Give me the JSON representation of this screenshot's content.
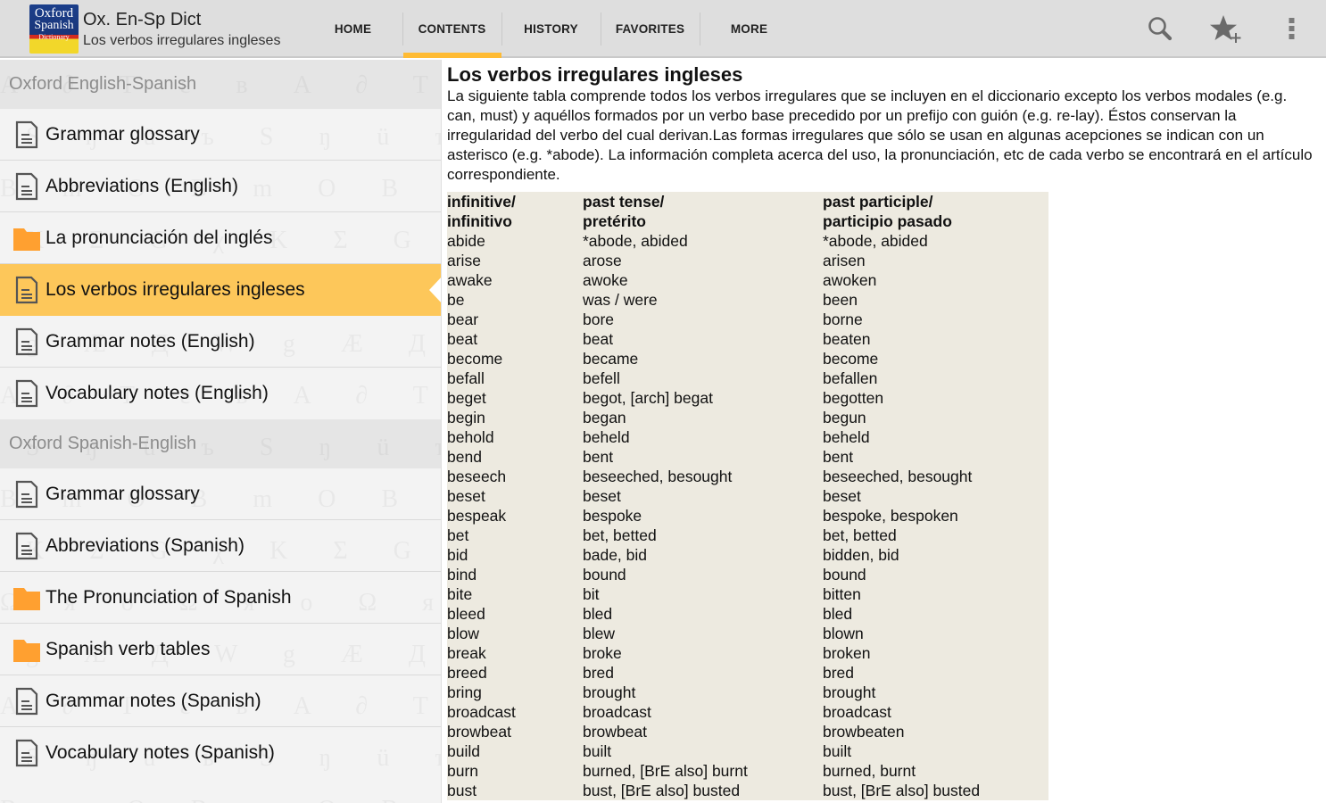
{
  "app": {
    "logo_lines": [
      "Oxford",
      "Spanish",
      "Dictionary"
    ],
    "title": "Ox. En-Sp Dict",
    "subtitle": "Los verbos irregulares ingleses"
  },
  "tabs": [
    {
      "label": "HOME",
      "active": false
    },
    {
      "label": "CONTENTS",
      "active": true
    },
    {
      "label": "HISTORY",
      "active": false
    },
    {
      "label": "FAVORITES",
      "active": false
    },
    {
      "label": "MORE",
      "active": false
    }
  ],
  "actions": [
    {
      "icon": "search-icon"
    },
    {
      "icon": "add-favorite-star-icon"
    },
    {
      "icon": "overflow-menu-icon"
    }
  ],
  "colors": {
    "accent": "#ffbb33",
    "selected_item": "#fdc75a",
    "folder": "#ffa030",
    "table_bg": "#edeae0",
    "actionbar": "#dedede"
  },
  "sidebar": {
    "sections": [
      {
        "header": "Oxford English-Spanish",
        "items": [
          {
            "label": "Grammar glossary",
            "icon": "document-icon",
            "selected": false
          },
          {
            "label": "Abbreviations (English)",
            "icon": "document-icon",
            "selected": false
          },
          {
            "label": "La pronunciación del inglés",
            "icon": "folder-icon",
            "selected": false
          },
          {
            "label": "Los verbos irregulares ingleses",
            "icon": "document-icon",
            "selected": true
          },
          {
            "label": "Grammar notes (English)",
            "icon": "document-icon",
            "selected": false
          },
          {
            "label": "Vocabulary notes (English)",
            "icon": "document-icon",
            "selected": false
          }
        ]
      },
      {
        "header": "Oxford Spanish-English",
        "items": [
          {
            "label": "Grammar glossary",
            "icon": "document-icon",
            "selected": false
          },
          {
            "label": "Abbreviations (Spanish)",
            "icon": "document-icon",
            "selected": false
          },
          {
            "label": "The Pronunciation of Spanish",
            "icon": "folder-icon",
            "selected": false
          },
          {
            "label": "Spanish verb tables",
            "icon": "folder-icon",
            "selected": false
          },
          {
            "label": "Grammar notes (Spanish)",
            "icon": "document-icon",
            "selected": false
          },
          {
            "label": "Vocabulary notes (Spanish)",
            "icon": "document-icon",
            "selected": false
          }
        ]
      }
    ]
  },
  "content": {
    "title": "Los verbos irregulares ingleses",
    "intro": "La siguiente tabla comprende todos los verbos irregulares que se incluyen en el diccionario excepto los verbos modales (e.g. can, must) y aquéllos formados por un verbo base precedido por un prefijo con guión (e.g. re-lay). Éstos conservan la irregularidad del verbo del cual derivan.Las formas irregulares que sólo se usan en algunas acepciones se indican con un asterisco (e.g. *abode). La información completa acerca del uso, la pronunciación, etc de cada verbo se encontrará en el artículo correspondiente.",
    "table": {
      "headers": [
        [
          "infinitive/",
          "infinitivo"
        ],
        [
          "past tense/",
          "pretérito"
        ],
        [
          "past participle/",
          "participio pasado"
        ]
      ],
      "rows": [
        [
          "abide",
          "*abode, abided",
          "*abode, abided"
        ],
        [
          "arise",
          "arose",
          "arisen"
        ],
        [
          "awake",
          "awoke",
          "awoken"
        ],
        [
          "be",
          "was / were",
          "been"
        ],
        [
          "bear",
          "bore",
          "borne"
        ],
        [
          "beat",
          "beat",
          "beaten"
        ],
        [
          "become",
          "became",
          "become"
        ],
        [
          "befall",
          "befell",
          "befallen"
        ],
        [
          "beget",
          "begot, [arch] begat",
          "begotten"
        ],
        [
          "begin",
          "began",
          "begun"
        ],
        [
          "behold",
          "beheld",
          "beheld"
        ],
        [
          "bend",
          "bent",
          "bent"
        ],
        [
          "beseech",
          "beseeched, besought",
          "beseeched, besought"
        ],
        [
          "beset",
          "beset",
          "beset"
        ],
        [
          "bespeak",
          "bespoke",
          "bespoke, bespoken"
        ],
        [
          "bet",
          "bet, betted",
          "bet, betted"
        ],
        [
          "bid",
          "bade, bid",
          "bidden, bid"
        ],
        [
          "bind",
          "bound",
          "bound"
        ],
        [
          "bite",
          "bit",
          "bitten"
        ],
        [
          "bleed",
          "bled",
          "bled"
        ],
        [
          "blow",
          "blew",
          "blown"
        ],
        [
          "break",
          "broke",
          "broken"
        ],
        [
          "breed",
          "bred",
          "bred"
        ],
        [
          "bring",
          "brought",
          "brought"
        ],
        [
          "broadcast",
          "broadcast",
          "broadcast"
        ],
        [
          "browbeat",
          "browbeat",
          "browbeaten"
        ],
        [
          "build",
          "built",
          "built"
        ],
        [
          "burn",
          "burned, [BrE also] burnt",
          "burned, burnt"
        ],
        [
          "bust",
          "bust, [BrE also] busted",
          "bust, [BrE also] busted"
        ]
      ]
    }
  }
}
